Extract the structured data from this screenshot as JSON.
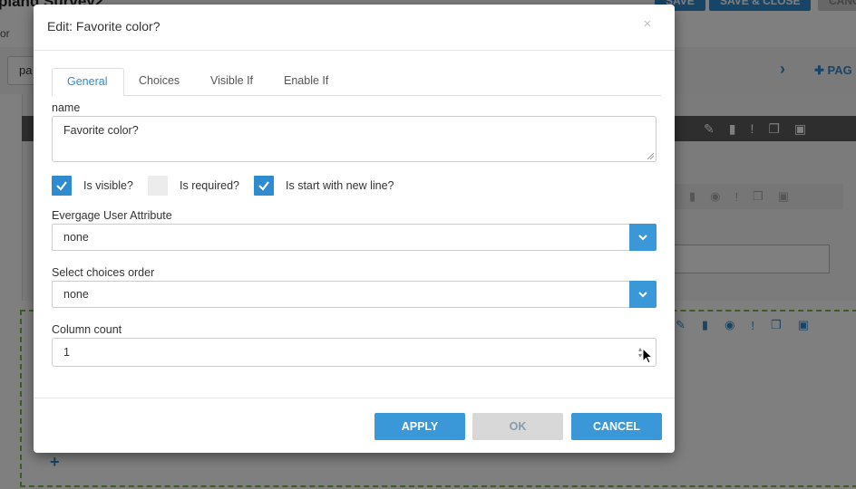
{
  "background": {
    "title": "pland Survey2",
    "subbar_text": "or",
    "page_select": "pa",
    "add_page": "PAG",
    "buttons": [
      "SAVE",
      "SAVE & CLOSE",
      "CANC"
    ]
  },
  "modal": {
    "title": "Edit: Favorite color?",
    "close_glyph": "×",
    "tabs": [
      "General",
      "Choices",
      "Visible If",
      "Enable If"
    ],
    "active_tab": "General",
    "name_label": "name",
    "name_value": "Favorite color?",
    "checkboxes": [
      {
        "label": "Is visible?",
        "checked": true
      },
      {
        "label": "Is required?",
        "checked": false
      },
      {
        "label": "Is start with new line?",
        "checked": true
      }
    ],
    "user_attr_label": "Evergage User Attribute",
    "user_attr_value": "none",
    "choices_order_label": "Select choices order",
    "choices_order_value": "none",
    "column_count_label": "Column count",
    "column_count_value": "1",
    "buttons": {
      "apply": "APPLY",
      "ok": "OK",
      "cancel": "CANCEL"
    }
  },
  "colors": {
    "accent": "#3a97d8",
    "checkbox_on": "#2f8bd0",
    "disabled_button": "#d8d8d8"
  }
}
